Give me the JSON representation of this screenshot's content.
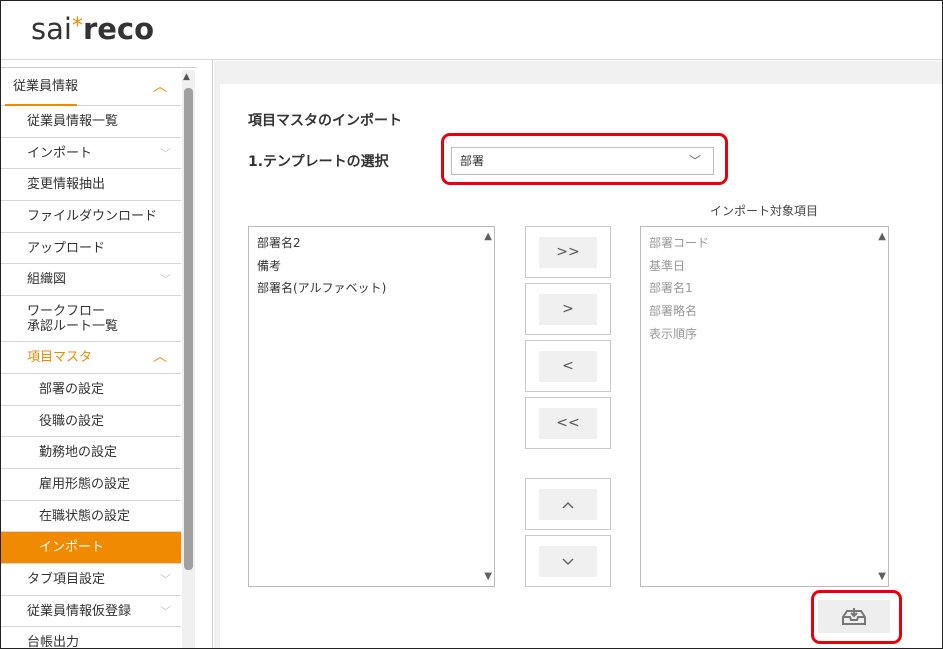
{
  "logo": {
    "part1": "sai",
    "star": "*",
    "part2": "reco"
  },
  "sidebar": {
    "section": "従業員情報",
    "items": [
      {
        "label": "従業員情報一覧"
      },
      {
        "label": "インポート"
      },
      {
        "label": "変更情報抽出"
      },
      {
        "label": "ファイルダウンロード"
      },
      {
        "label": "アップロード"
      },
      {
        "label": "組織図"
      },
      {
        "label_line1": "ワークフロー",
        "label_line2": "承認ルート一覧"
      },
      {
        "label": "項目マスタ"
      },
      {
        "label": "部署の設定"
      },
      {
        "label": "役職の設定"
      },
      {
        "label": "勤務地の設定"
      },
      {
        "label": "雇用形態の設定"
      },
      {
        "label": "在職状態の設定"
      },
      {
        "label": "インポート"
      },
      {
        "label": "タブ項目設定"
      },
      {
        "label": "従業員情報仮登録"
      },
      {
        "label": "台帳出力"
      }
    ]
  },
  "main": {
    "heading": "項目マスタのインポート",
    "template_label": "1.テンプレートの選択",
    "template_select": {
      "value": "部署"
    },
    "target_title": "インポート対象項目",
    "available_items": [
      "部署名2",
      "備考",
      "部署名(アルファベット)"
    ],
    "target_items": [
      "部署コード",
      "基準日",
      "部署名1",
      "部署略名",
      "表示順序"
    ],
    "buttons": {
      "add_all": ">>",
      "add": ">",
      "remove": "<",
      "remove_all": "<<",
      "move_up": "^",
      "move_down": "v"
    }
  },
  "colors": {
    "accent": "#f08a00",
    "highlight": "#e8000b"
  }
}
